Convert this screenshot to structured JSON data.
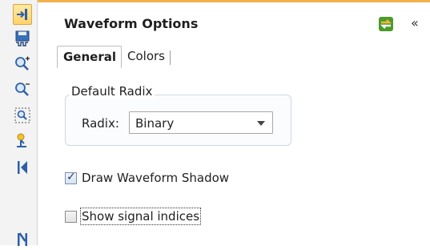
{
  "toolbar": {
    "buttons": [
      {
        "name": "insert-cursor-icon",
        "active": true
      },
      {
        "name": "save-format-icon"
      },
      {
        "name": "zoom-in-icon"
      },
      {
        "name": "zoom-out-icon"
      },
      {
        "name": "zoom-fit-icon"
      },
      {
        "name": "cursor-marker-icon"
      },
      {
        "name": "go-first-icon"
      },
      {
        "name": "go-next-icon"
      }
    ]
  },
  "panel": {
    "title": "Waveform Options",
    "header_icons": [
      "sync-icon",
      "collapse-icon"
    ],
    "collapse_glyph": "«",
    "accent_color": "#f2b24e"
  },
  "tabs": [
    {
      "label": "General",
      "selected": true
    },
    {
      "label": "Colors",
      "selected": false
    }
  ],
  "default_radix": {
    "legend": "Default Radix",
    "label": "Radix:",
    "value": "Binary"
  },
  "options": {
    "draw_shadow": {
      "label": "Draw Waveform Shadow",
      "checked": true
    },
    "show_indices": {
      "label": "Show signal indices",
      "checked": false
    }
  }
}
